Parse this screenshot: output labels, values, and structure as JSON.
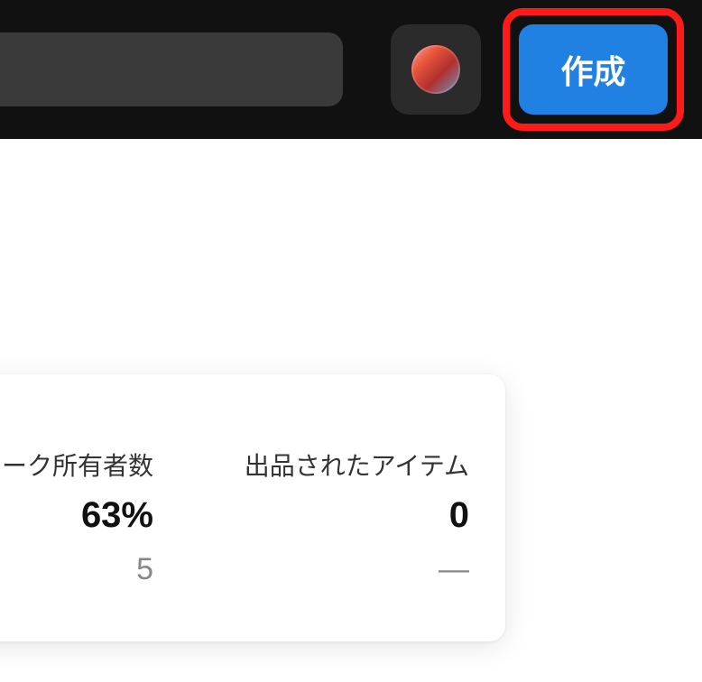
{
  "header": {
    "create_label": "作成"
  },
  "stats": {
    "col1": {
      "label": "ニーク所有者数",
      "value": "63%",
      "sub": "5"
    },
    "col2": {
      "label": "出品されたアイテム",
      "value": "0",
      "sub": "—"
    }
  },
  "colors": {
    "highlight": "#ff1a1a",
    "primary": "#2081e2"
  }
}
